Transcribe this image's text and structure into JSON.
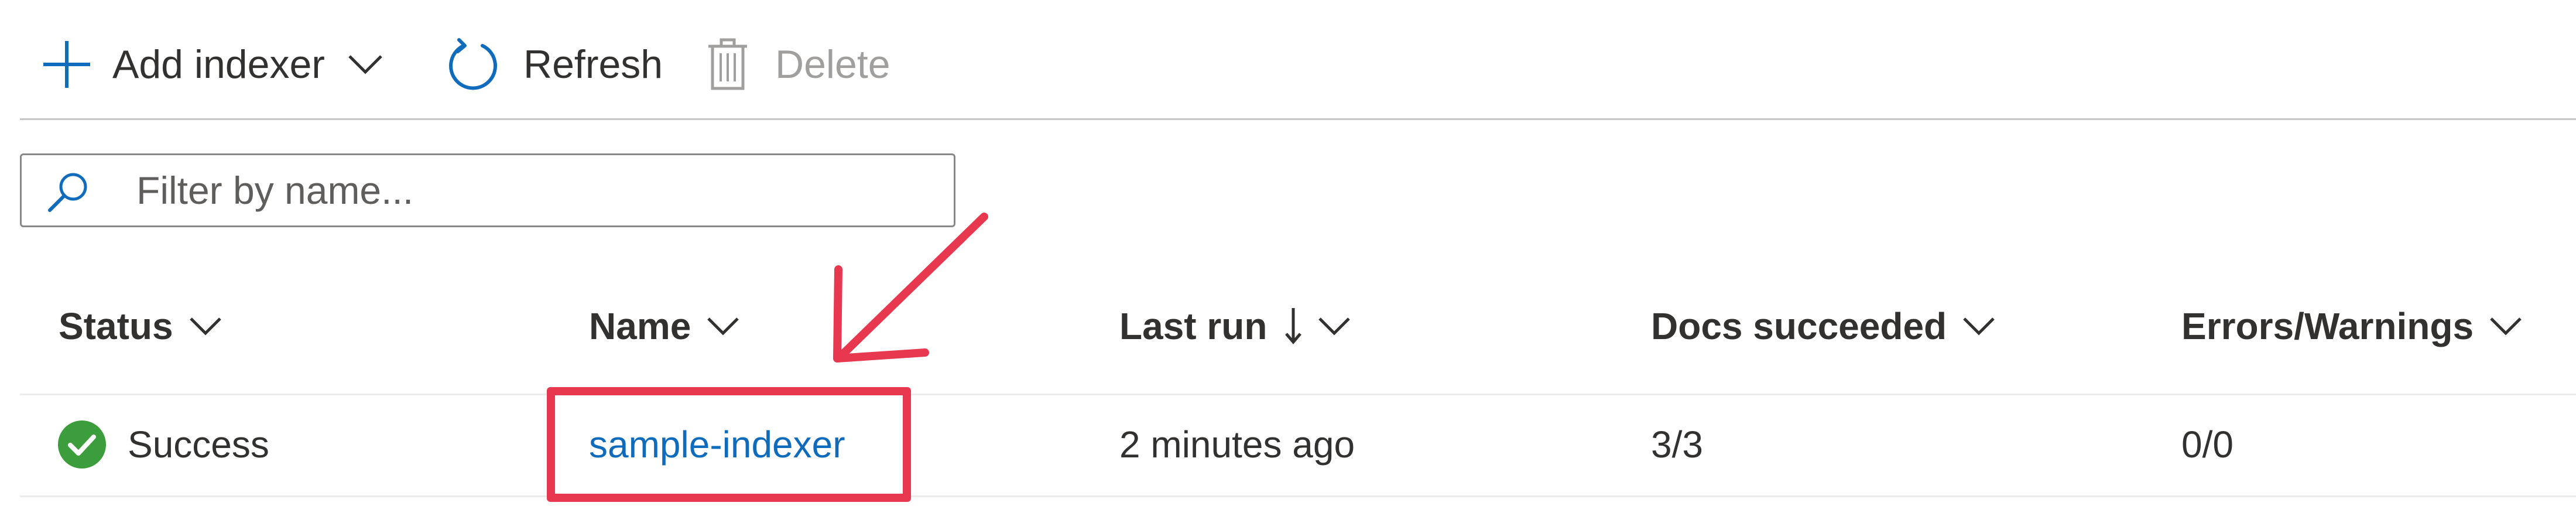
{
  "toolbar": {
    "add_label": "Add indexer",
    "refresh_label": "Refresh",
    "delete_label": "Delete"
  },
  "filter": {
    "placeholder": "Filter by name...",
    "value": ""
  },
  "table": {
    "columns": [
      {
        "label": "Status",
        "sorted": false
      },
      {
        "label": "Name",
        "sorted": false
      },
      {
        "label": "Last run",
        "sorted": true,
        "sort_direction": "descending"
      },
      {
        "label": "Docs succeeded",
        "sorted": false
      },
      {
        "label": "Errors/Warnings",
        "sorted": false
      }
    ],
    "rows": [
      {
        "status": "Success",
        "name": "sample-indexer",
        "last_run": "2 minutes ago",
        "docs_succeeded": "3/3",
        "errors_warnings": "0/0"
      }
    ]
  },
  "colors": {
    "accent": "#0f6cbd",
    "success": "#3c9d3c",
    "annotation": "#e8384f",
    "disabled": "#a19f9d"
  },
  "icons": {
    "add": "plus-icon",
    "add_menu": "chevron-down-icon",
    "refresh": "refresh-icon",
    "delete": "trash-icon",
    "search": "search-icon",
    "status": "success-check-icon",
    "sort": "arrow-down-icon"
  }
}
